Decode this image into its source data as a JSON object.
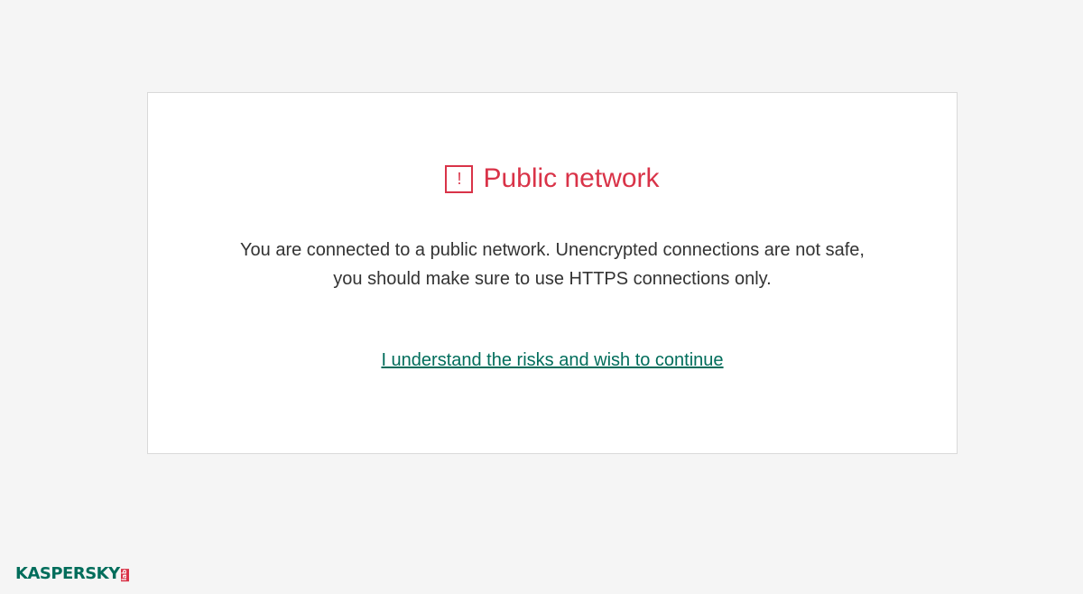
{
  "header": {
    "title": "Public network",
    "icon": "exclamation-icon",
    "icon_glyph": "!",
    "accent_color": "#d93348"
  },
  "message": {
    "line1": "You are connected to a public network. Unencrypted connections are not safe,",
    "line2": "you should make sure to use HTTPS connections only."
  },
  "actions": {
    "continue_label": "I understand the risks and wish to continue",
    "link_color": "#006d5b"
  },
  "branding": {
    "logo_text": "KASPERSKY",
    "logo_suffix": "lab"
  }
}
